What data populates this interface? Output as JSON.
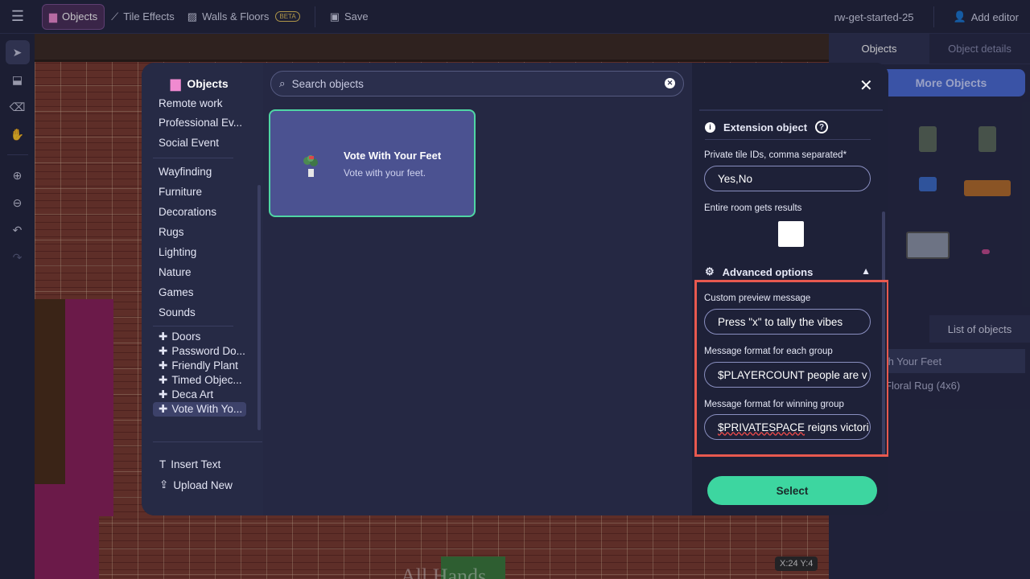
{
  "topbar": {
    "objects_label": "Objects",
    "tile_effects_label": "Tile Effects",
    "walls_floors_label": "Walls & Floors",
    "beta_badge": "BETA",
    "save_label": "Save",
    "map_name": "rw-get-started-25",
    "add_editor_label": "Add editor"
  },
  "tools": [
    "select-arrow-icon",
    "stamp-icon",
    "eraser-icon",
    "hand-icon",
    "zoom-in-icon",
    "zoom-out-icon",
    "undo-icon",
    "redo-icon"
  ],
  "map": {
    "coordinates": "X:24  Y:4",
    "sign_text": "All Hands"
  },
  "right_panel": {
    "tab_objects": "Objects",
    "tab_object_details": "Object details",
    "more_objects_label": "More Objects",
    "list_tab_label": "List of objects",
    "list_item_1": "th Your Feet",
    "list_item_2": "Floral Rug (4x6)"
  },
  "modal": {
    "title": "Objects",
    "categories": [
      "Remote work",
      "Professional Ev...",
      "Social Event"
    ],
    "categories2": [
      "Wayfinding",
      "Furniture",
      "Decorations",
      "Rugs",
      "Lighting",
      "Nature",
      "Games",
      "Sounds"
    ],
    "extensions": [
      "Doors",
      "Password Do...",
      "Friendly Plant",
      "Timed Objec...",
      "Deca Art",
      "Vote With Yo..."
    ],
    "insert_text_label": "Insert Text",
    "upload_new_label": "Upload New",
    "search_placeholder": "Search objects",
    "card": {
      "title": "Vote With Your Feet",
      "description": "Vote with your feet."
    },
    "details": {
      "extension_heading": "Extension object",
      "private_tile_label": "Private tile IDs, comma separated*",
      "private_tile_value": "Yes,No",
      "entire_room_label": "Entire room gets results",
      "entire_room_checked": false,
      "advanced_label": "Advanced options",
      "preview_label": "Custom preview message",
      "preview_value": "Press \"x\" to tally the vibes",
      "group_format_label": "Message format for each group",
      "group_format_value": "$PLAYERCOUNT people are v",
      "winning_label": "Message format for winning group",
      "winning_value_token": "$PRIVATESPACE",
      "winning_value_rest": " reigns victori",
      "select_label": "Select"
    },
    "colors": {
      "accent_green": "#3dd6a0",
      "highlight_red": "#e8594f",
      "card_bg": "#4b5291",
      "more_objects_blue": "#4a6bd6"
    }
  }
}
